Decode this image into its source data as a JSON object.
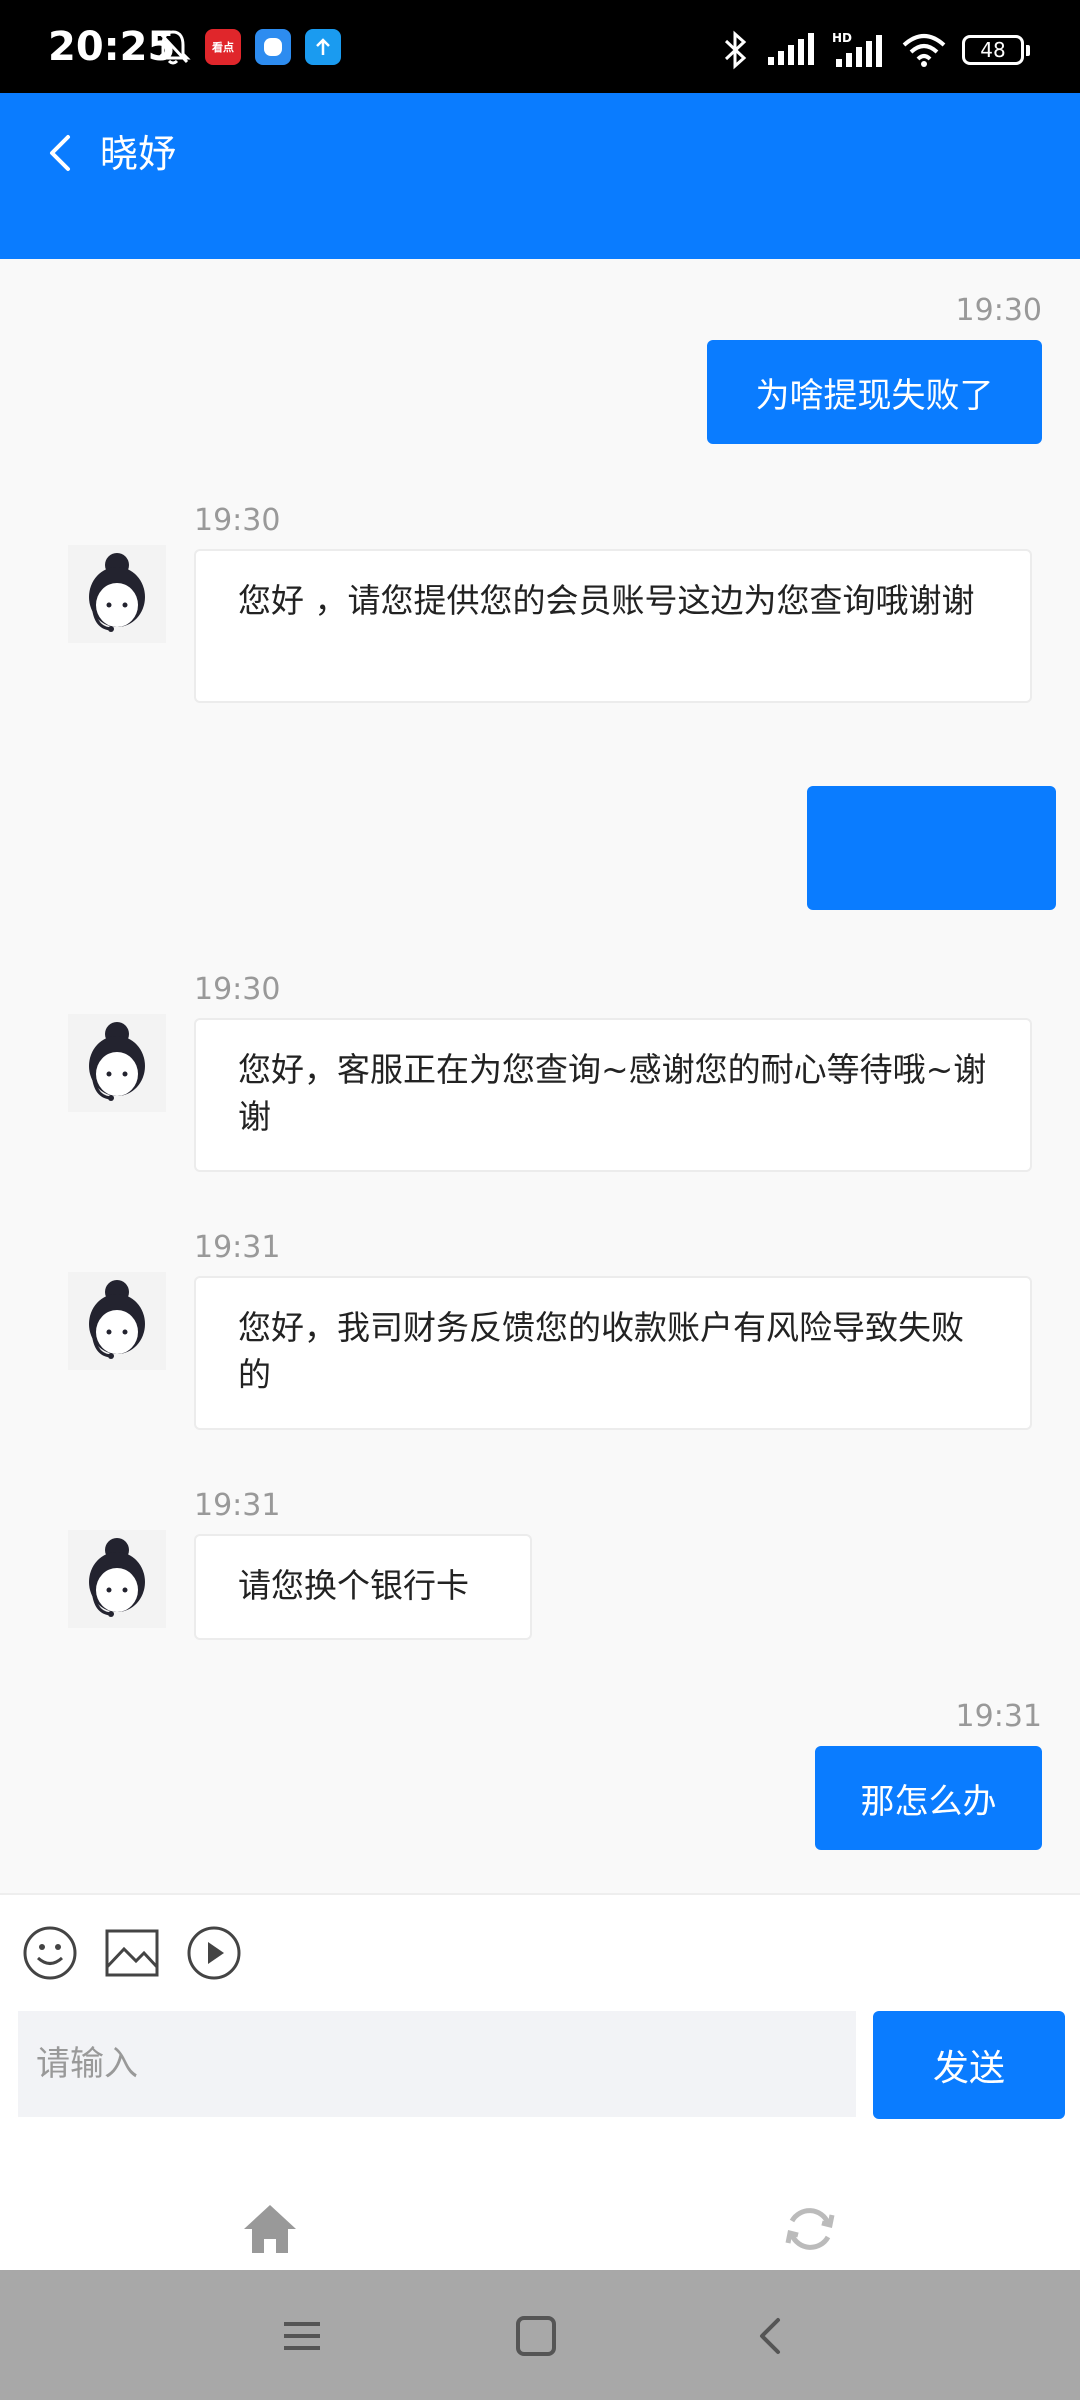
{
  "status_bar": {
    "time": "20:25",
    "app_badge_label": "看点",
    "battery": "48"
  },
  "header": {
    "title": "晓妤"
  },
  "messages": [
    {
      "from": "me",
      "time": "19:30",
      "text": "为啥提现失败了"
    },
    {
      "from": "agent",
      "time": "19:30",
      "text": "您好 ，请您提供您的会员账号这边为您查询哦谢谢"
    },
    {
      "from": "me",
      "time": "",
      "text": ""
    },
    {
      "from": "agent",
      "time": "19:30",
      "text": "您好，客服正在为您查询~感谢您的耐心等待哦~谢谢"
    },
    {
      "from": "agent",
      "time": "19:31",
      "text": "您好，我司财务反馈您的收款账户有风险导致失败的"
    },
    {
      "from": "agent",
      "time": "19:31",
      "text": "请您换个银行卡"
    },
    {
      "from": "me",
      "time": "19:31",
      "text": "那怎么办"
    }
  ],
  "composer": {
    "placeholder": "请输入",
    "send_label": "发送"
  },
  "icons": {
    "back": "chevron-left-icon",
    "emoji": "smile-icon",
    "image": "image-icon",
    "video": "play-icon",
    "home": "home-icon",
    "refresh": "refresh-icon"
  },
  "colors": {
    "accent": "#0a7cff",
    "background": "#f9f9f9"
  }
}
